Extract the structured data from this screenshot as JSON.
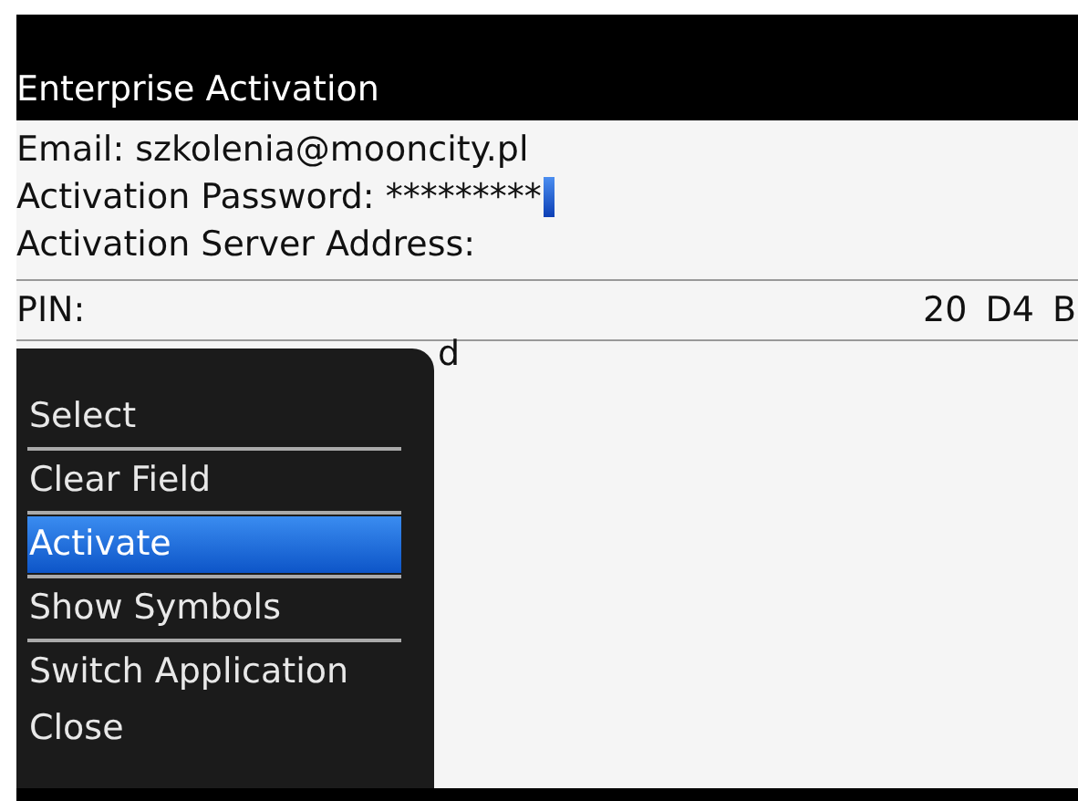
{
  "window": {
    "title": "Enterprise Activation"
  },
  "fields": [
    {
      "label": "Email:",
      "value": "szkolenia@mooncity.pl"
    },
    {
      "label": "Activation Password:",
      "value": "*********",
      "cursor": true
    },
    {
      "label": "Activation Server Address:"
    }
  ],
  "pin": {
    "label": "PIN:",
    "value": "20 D4 B"
  },
  "status_visible": "d",
  "menu": {
    "items": [
      {
        "kind": "item",
        "label": "Select",
        "selected": false
      },
      {
        "kind": "divider"
      },
      {
        "kind": "item",
        "label": "Clear Field",
        "selected": false
      },
      {
        "kind": "divider"
      },
      {
        "kind": "item",
        "label": "Activate",
        "selected": true
      },
      {
        "kind": "divider"
      },
      {
        "kind": "item",
        "label": "Show Symbols",
        "selected": false
      },
      {
        "kind": "divider"
      },
      {
        "kind": "item",
        "label": "Switch Application",
        "selected": false
      },
      {
        "kind": "item",
        "label": "Close",
        "selected": false
      }
    ]
  }
}
